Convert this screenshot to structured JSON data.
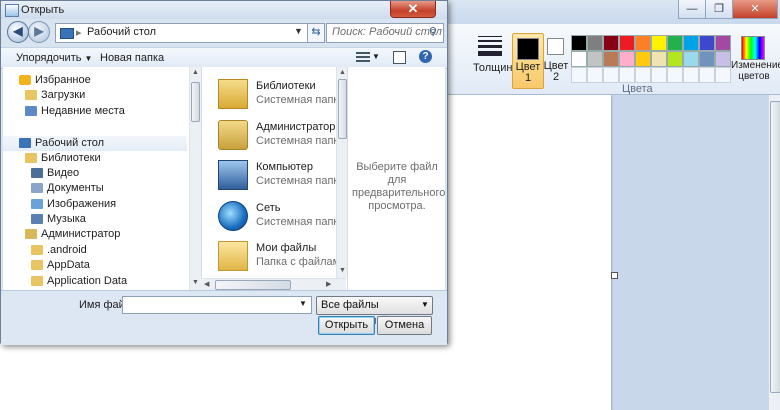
{
  "paint": {
    "ribbon": {
      "thickness_label": "Толщина",
      "color1_label": "Цвет 1",
      "color2_label": "Цвет 2",
      "edit_colors_label": "Изменение цветов",
      "colors_group_label": "Цвета",
      "color1_value": "#000000",
      "color2_value": "#ffffff",
      "palette_row1": [
        "#000000",
        "#7f7f7f",
        "#880015",
        "#ed1c24",
        "#ff7f27",
        "#fff200",
        "#22b14c",
        "#00a2e8",
        "#3f48cc",
        "#a349a4"
      ],
      "palette_row2": [
        "#ffffff",
        "#c3c3c3",
        "#b97a57",
        "#ffaec9",
        "#ffc90e",
        "#efe4b0",
        "#b5e61d",
        "#99d9ea",
        "#7092be",
        "#c8bfe7"
      ]
    },
    "window_buttons": [
      "—",
      "❐",
      "✕"
    ]
  },
  "dialog": {
    "title": "Открыть",
    "address_path": "Рабочий стол",
    "search_placeholder": "Поиск: Рабочий стол",
    "toolbar": {
      "organize_label": "Упорядочить",
      "new_folder_label": "Новая папка"
    },
    "nav_items": [
      {
        "label": "Избранное",
        "icon": "star-icon"
      },
      {
        "label": "Загрузки",
        "icon": "downloads-folder-icon"
      },
      {
        "label": "Недавние места",
        "icon": "recent-places-icon"
      },
      {
        "label": "Рабочий стол",
        "icon": "desktop-icon"
      },
      {
        "label": "Библиотеки",
        "icon": "libraries-icon"
      },
      {
        "label": "Видео",
        "icon": "video-library-icon"
      },
      {
        "label": "Документы",
        "icon": "documents-library-icon"
      },
      {
        "label": "Изображения",
        "icon": "pictures-library-icon"
      },
      {
        "label": "Музыка",
        "icon": "music-library-icon"
      },
      {
        "label": "Администратор",
        "icon": "user-folder-icon"
      },
      {
        "label": ".android",
        "icon": "folder-icon"
      },
      {
        "label": "AppData",
        "icon": "folder-icon"
      },
      {
        "label": "Application Data",
        "icon": "shortcut-folder-icon"
      }
    ],
    "files": [
      {
        "name": "Библиотеки",
        "type": "Системная папка",
        "icon": "libraries-icon"
      },
      {
        "name": "Администратор",
        "type": "Системная папка",
        "icon": "user-icon"
      },
      {
        "name": "Компьютер",
        "type": "Системная папка",
        "icon": "computer-icon"
      },
      {
        "name": "Сеть",
        "type": "Системная папка",
        "icon": "network-icon"
      },
      {
        "name": "Мои файлы",
        "type": "Папка с файлами",
        "icon": "folder-icon"
      }
    ],
    "preview_text": "Выберите файл для предварительного просмотра.",
    "filename_label": "Имя файла:",
    "filename_value": "",
    "filter_value": "Все файлы изображений",
    "open_label": "Открыть",
    "cancel_label": "Отмена"
  }
}
